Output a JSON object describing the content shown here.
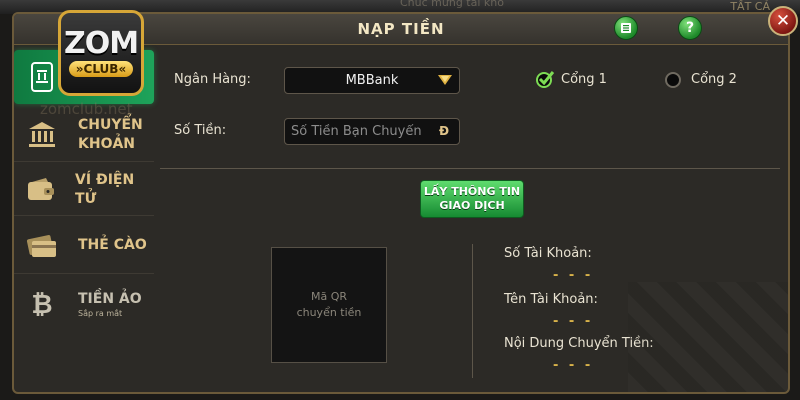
{
  "header": {
    "title": "NẠP TIỀN"
  },
  "brand": {
    "logo_main": "ZOM",
    "logo_sub": "»CLUB«",
    "watermark": "zomclub.net"
  },
  "background": {
    "right_text": "TẤT CẢ",
    "mid_text": "Chúc mừng tài khỏ"
  },
  "sidebar": {
    "items": [
      {
        "label": "",
        "icon": "mobile-bank-icon",
        "active": true
      },
      {
        "label_line1": "CHUYỂN",
        "label_line2": "KHOẢN",
        "icon": "bank-icon"
      },
      {
        "label": "VÍ ĐIỆN TỬ",
        "icon": "wallet-icon"
      },
      {
        "label": "THẺ CÀO",
        "icon": "card-icon"
      },
      {
        "label": "TIỀN ẢO",
        "sublabel": "Sắp ra mắt",
        "icon": "bitcoin-icon"
      }
    ]
  },
  "form": {
    "bank_label": "Ngân Hàng:",
    "bank_value": "MBBank",
    "amount_label": "Số Tiền:",
    "amount_placeholder": "Số Tiền Bạn Chuyển",
    "currency_symbol": "Đ",
    "gate1": {
      "label": "Cổng 1",
      "checked": true
    },
    "gate2": {
      "label": "Cổng 2",
      "checked": false
    }
  },
  "actions": {
    "get_info_line1": "LẤY THÔNG TIN",
    "get_info_line2": "GIAO DỊCH"
  },
  "qr": {
    "placeholder": "Mã QR\nchuyển tiền"
  },
  "info": {
    "account_number_label": "Số Tài Khoản:",
    "account_number_value": "- - -",
    "account_name_label": "Tên Tài Khoản:",
    "account_name_value": "- - -",
    "content_label": "Nội Dung Chuyển Tiền:",
    "content_value": "- - -"
  },
  "colors": {
    "accent_green": "#1ea35a",
    "gold": "#d6a637",
    "value_gold": "#d8b24a",
    "close_red": "#7a1410"
  }
}
